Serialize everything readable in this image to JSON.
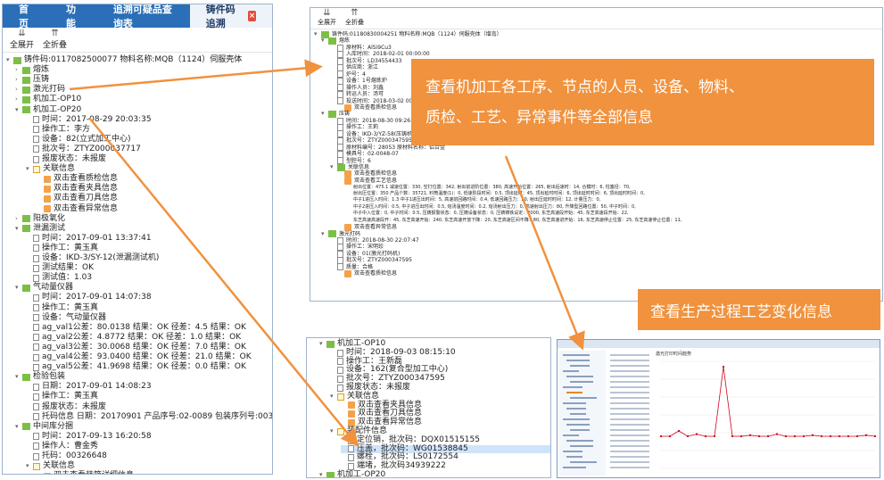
{
  "left_panel": {
    "tabs": [
      "首页",
      "功能",
      "追溯可疑品查询表",
      "铸件码追溯"
    ],
    "tab_close": "×",
    "toolbar": {
      "expand": "全展开",
      "collapse": "全折叠"
    },
    "root": "铸件码:0117082500077 物料名称:MQB（1124）伺服壳体",
    "nodes": [
      "熔炼",
      "压铸",
      "激光打码",
      "机加工-OP10",
      "机加工-OP20"
    ],
    "op20_fields": [
      "时间：2017-08-29 20:03:35",
      "操作工：李方",
      "设备：82(立式加工中心)",
      "批次号：ZTYZ000037717",
      "报废状态：未报废"
    ],
    "relate_title": "关联信息",
    "relate_items": [
      "双击查看质检信息",
      "双击查看夹具信息",
      "双击查看刀具信息",
      "双击查看异常信息"
    ],
    "anodize": "阳极氧化",
    "leak_test": "泄漏测试",
    "leak_fields": [
      "时间：2017-09-01 13:37:41",
      "操作工：黄玉真",
      "设备：IKD-3/SY-12(泄漏测试机)",
      "测试结果：OK",
      "测试值：1.03"
    ],
    "gauge": "气动量仪器",
    "gauge_fields": [
      "时间：2017-09-01 14:07:38",
      "操作工：黄玉真",
      "设备：气动量仪器"
    ],
    "gauge_vals": [
      "ag_val1公差：80.0138   结果：OK   径差：4.5   结果：OK",
      "ag_val2公差：4.8772   结果：OK   径差：1.0   结果：OK",
      "ag_val3公差：30.0068   结果：OK   径差：7.0   结果：OK",
      "ag_val4公差：93.0400   结果：OK   径差：21.0   结果：OK",
      "ag_val5公差：41.9698   结果：OK   径差：0.0   结果：OK"
    ],
    "pack": "检验包装",
    "pack_fields": [
      "日期：2017-09-01 14:08:23",
      "操作工：黄玉真",
      "报废状态：未报废",
      "托码信息   日期：20170901   产品序号:02-0089   包装序列号:00326648"
    ],
    "warehouse": "中间库分捆",
    "wh_fields": [
      "时间：2017-09-13 16:20:58",
      "操作人：曹金秀",
      "托码：00326648"
    ],
    "wh_relate": "关联信息",
    "wh_relate_item": "双击查看装箱详细信息"
  },
  "top_right": {
    "toolbar": {
      "expand": "全展开",
      "collapse": "全折叠"
    },
    "root": "铸件码:01180830004251 物料名称:MQB（1124）伺服壳体（增岛）",
    "rows": [
      "熔炼",
      "原材料：AlSi9Cu3",
      "入库时间：2018-02-01 00:00:00",
      "批次号：LD34554433",
      "供应商：浙江",
      "炉号：4",
      "设备：1号熔炼炉",
      "操作人员：刘鑫",
      "转运人员：汤可",
      "投送时间：2018-03-02 00:00:52",
      "双击查看质检信息",
      "压铸",
      "时间：2018-08-30 09:26:09",
      "操作工：王莉",
      "设备：IKD-3/YZ-58(压铸机)",
      "批次号：ZTYZ000347595",
      "原材料编号：28053   原材料名称：铝合金",
      "模具号：02-0048-07",
      "型腔号：6",
      "关联信息",
      "双击查看质检信息",
      "双击查看工艺信息"
    ],
    "process_params": [
      "射出位置：475.1   减速位置：330,   空打位置：342,   射出前进阶位置：380,   高速开始位置：265,   射出后速时：14,   合模时：6,   柱塞径：70,",
      "射出压位置：350   产品个数：35721,   料筒温度(1)：0,   低速阶段时间：0.5,   顶出延时：45,   顶出延时时间：6,   顶出延时时间：6,   顶出延时时间：0,",
      "中子1进压入时间：1.3   中子1进压出时间：5,   高速前回路时间：0.4,   低速回路压力：20,   射出压延时时间：12,   计量压力：0,",
      "中子2进压入时间：0.5,   中子进压出时间：0.5,   熔汤温度时间：0.2,   熔汤射出压力：0,   高速射出压力：80,   升降型回路位置：50,   中子时间：0,",
      "中子中入位置：0,   中子时间：0.5,   压铸报警状态：0,   压铸设备状态：0,   压铸铸铁设定：2000,   东芝高速段开始：45,   东芝高速段开始：22,",
      "东芝高速高速段开：45,   东芝高速开始：240,   东芝高速开放下降：20,   东芝高速区间不降：80,   东芝高速进开始：16,   东芝高速停止位置：25,   东芝高速停止位置：11,"
    ],
    "after_rows": [
      "双击查看异常信息",
      "激光打码",
      "时间：2018-08-30 22:07:47",
      "操作工：宋明珍",
      "设备：01(激光打码机)",
      "批次号：ZTYZ000347595",
      "质量：合格",
      "双击查看质检信息"
    ]
  },
  "bottom_mid": {
    "rows": [
      "机加工-OP10",
      "时间：2018-09-03 08:15:10",
      "操作工：王新磊",
      "设备：162(复合型加工中心)",
      "批次号：ZTYZ000347595",
      "报废状态：未报废",
      "关联信息",
      "双击查看夹具信息",
      "双击查看刀具信息",
      "双击查看异常信息",
      "装配件信息",
      "定位销，批次码：DQX01515155",
      "压盖，批次码：WG01538845",
      "螺栓，批次码：LS0172554",
      "端堵，批次码34939222",
      "机加工-OP20"
    ]
  },
  "chart_shot": {
    "title": "激光打印时间趋势",
    "values": [
      0.3,
      0.3,
      0.35,
      0.3,
      0.32,
      0.3,
      0.3,
      0.95,
      0.3,
      0.3,
      0.31,
      0.3,
      0.3,
      0.32,
      0.3,
      0.3,
      0.3,
      0.31,
      0.3,
      0.3,
      0.3,
      0.3,
      0.3,
      0.31,
      0.3
    ]
  },
  "callouts": {
    "top": "查看机加工各工序、节点的人员、设备、物料、质检、工艺、异常事件等全部信息",
    "line1": "查看机加工各工序、节点的人员、设备、物料、",
    "line2": "质检、工艺、异常事件等全部信息",
    "bottom": "查看生产过程工艺变化信息"
  },
  "colors": {
    "accent": "#f0923e",
    "tab_blue": "#2a6fb8",
    "node_green": "#7bbf45",
    "trend_red": "#d0021b"
  }
}
